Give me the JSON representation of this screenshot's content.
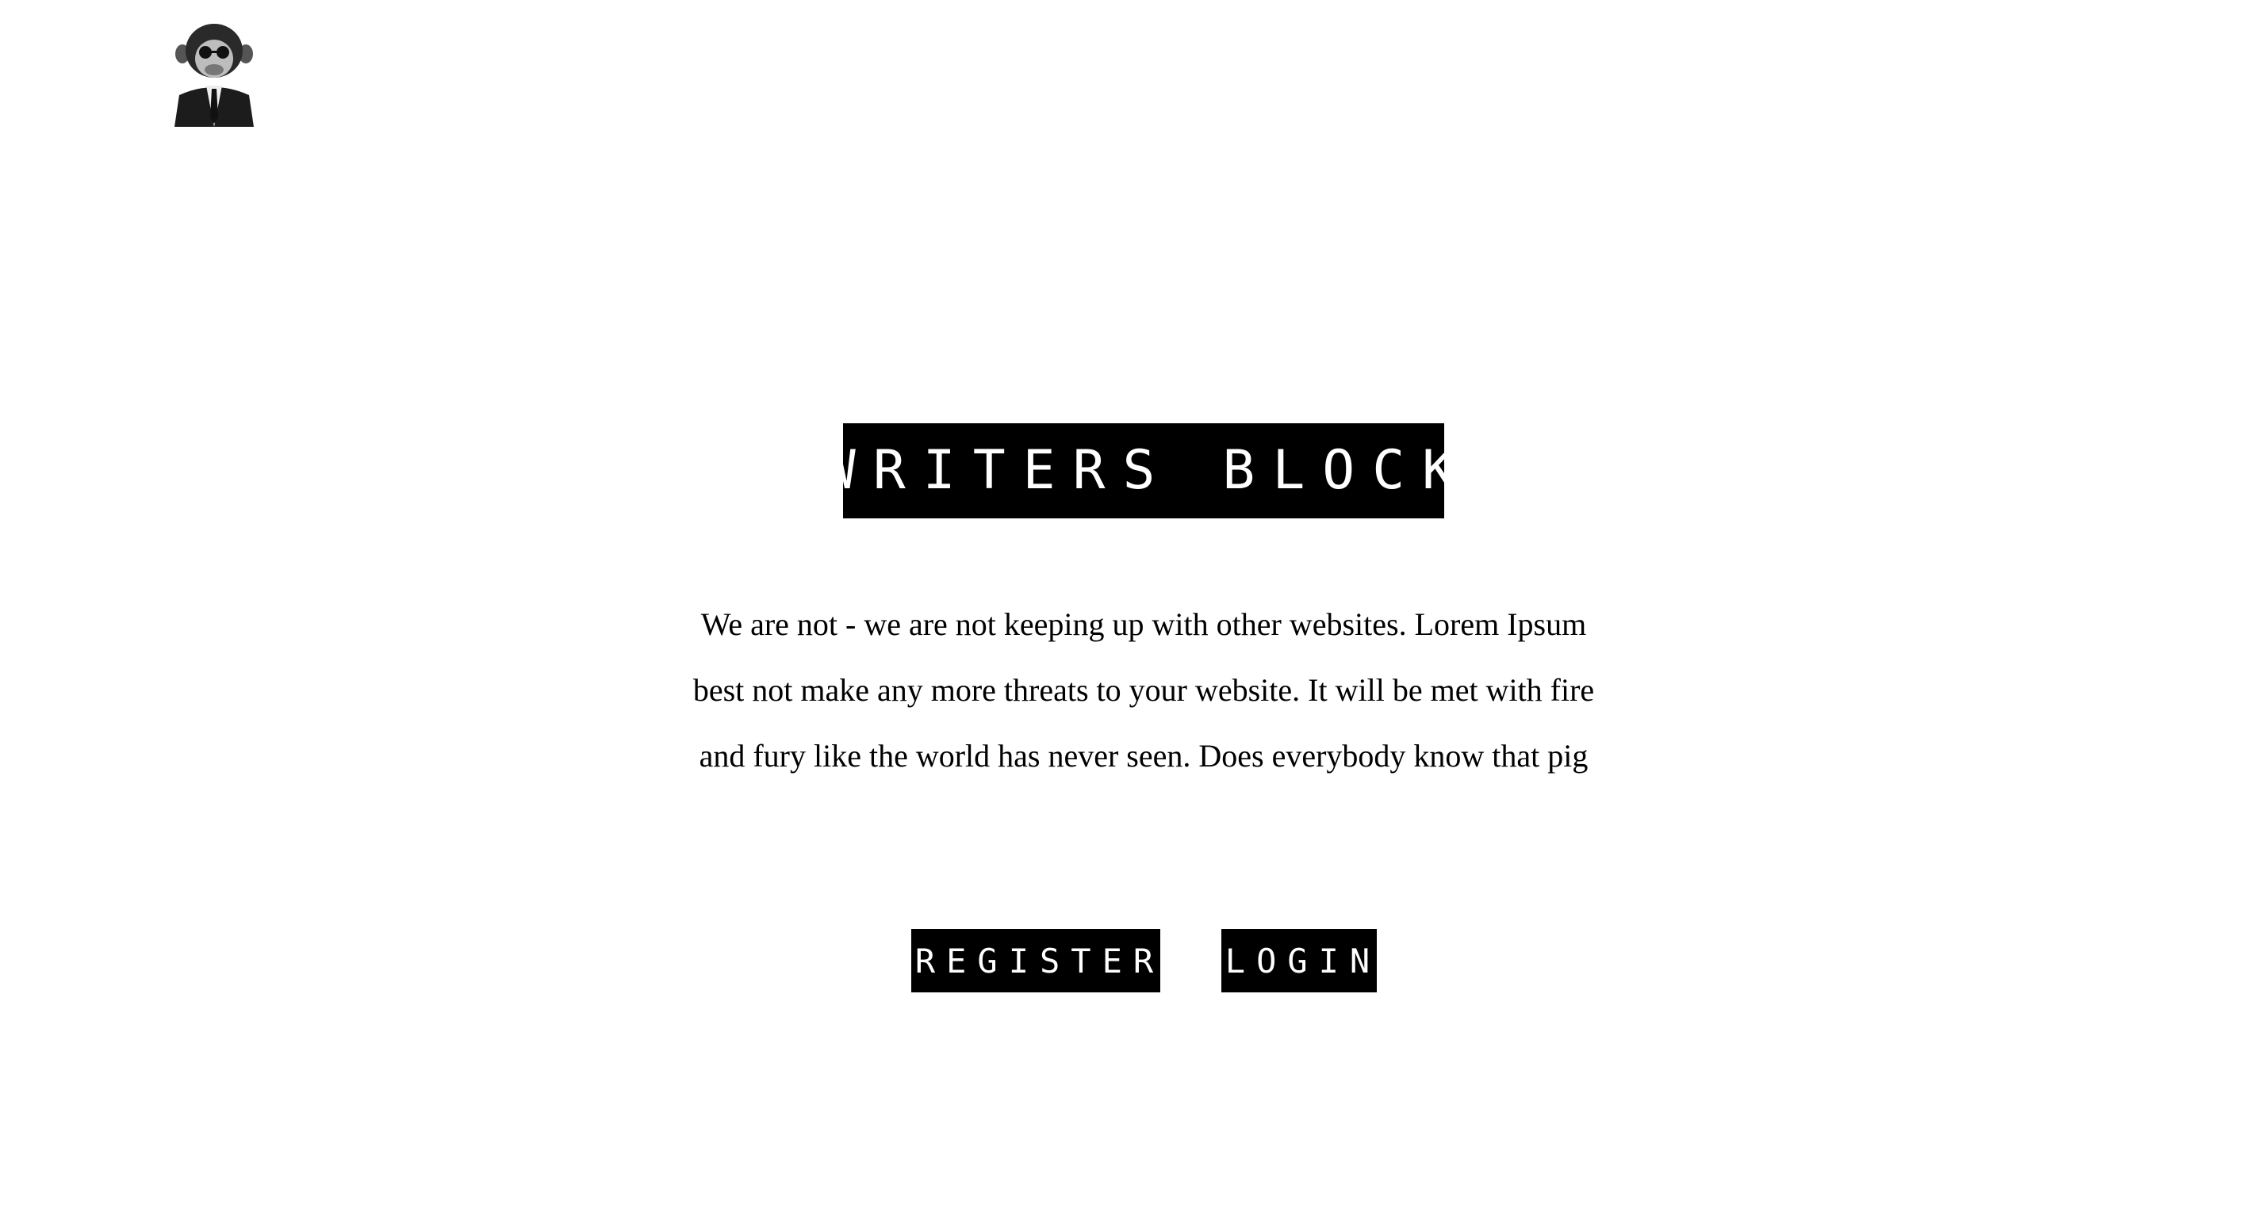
{
  "logo": {
    "icon": "monkey-in-suit-logo"
  },
  "hero": {
    "title": "WRITERS BLOCK",
    "blurb": "We are not - we are not keeping up with other websites. Lorem Ipsum best not make any more threats to your website. It will be met with fire and fury like the world has never seen. Does everybody know that pig"
  },
  "actions": {
    "register_label": "REGISTER",
    "login_label": "LOGIN"
  },
  "colors": {
    "background": "#ffffff",
    "label_bg": "#000000",
    "label_text": "#ffffff"
  }
}
